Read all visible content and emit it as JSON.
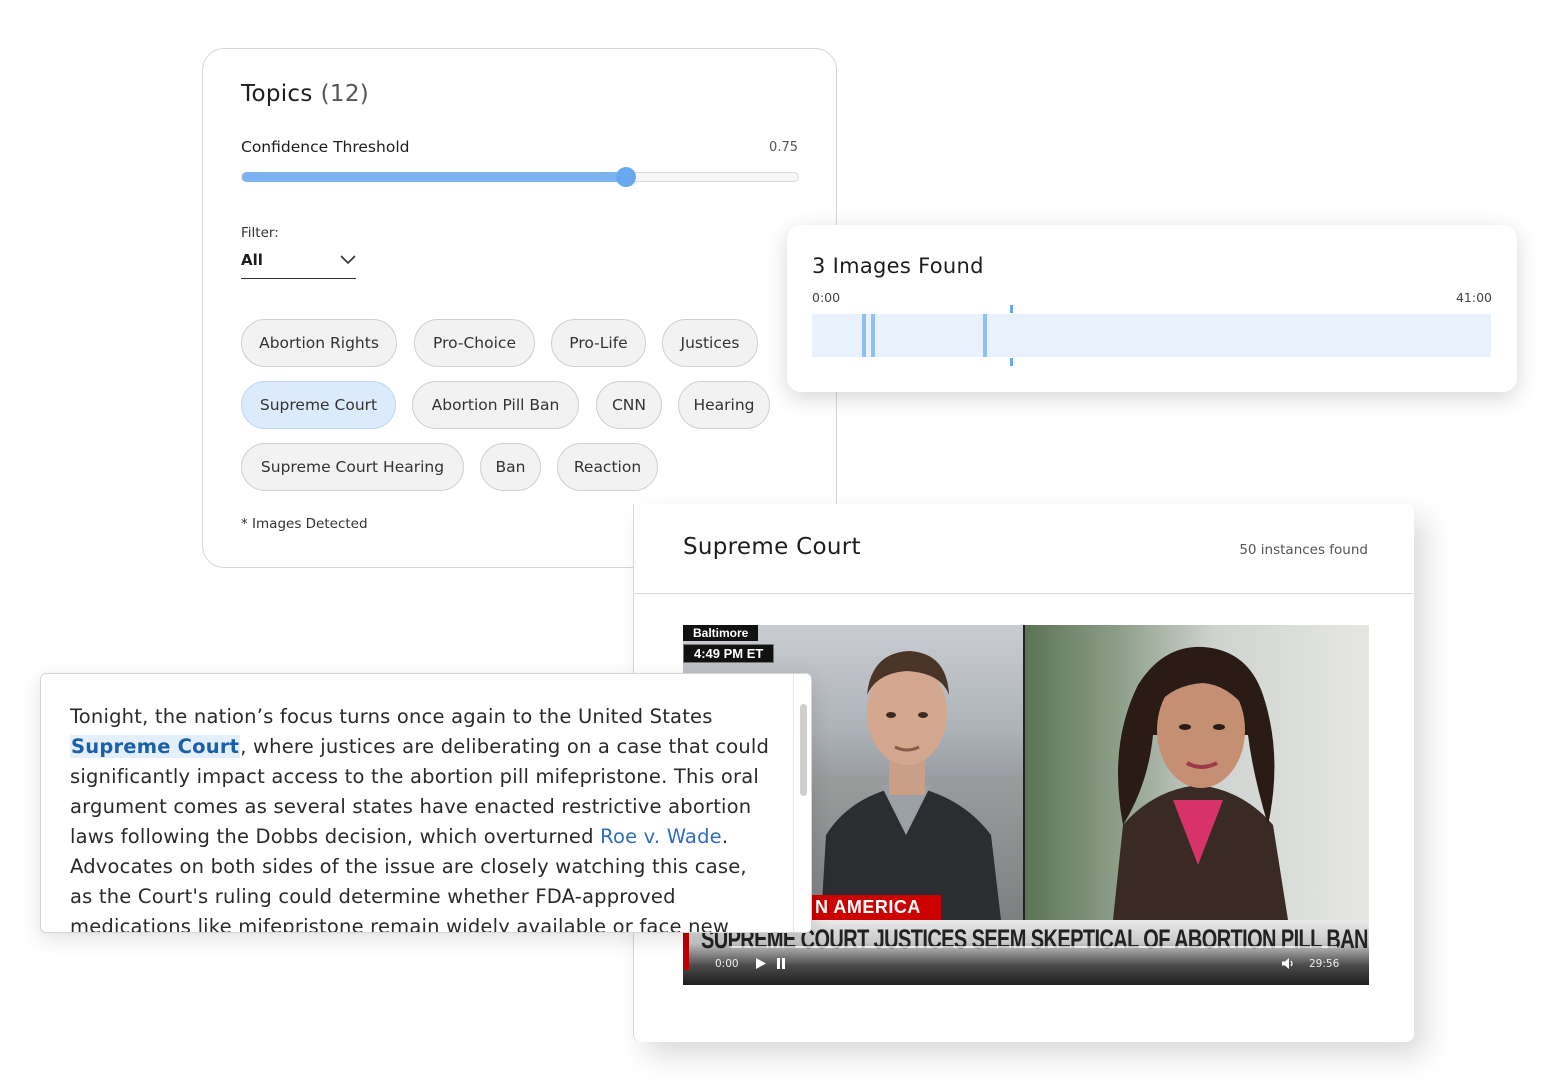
{
  "topics": {
    "title": "Topics",
    "count": "(12)",
    "confidence_label": "Confidence Threshold",
    "confidence_value": "0.75",
    "confidence_fraction": 0.69,
    "filter_label": "Filter:",
    "filter_value": "All",
    "chips": [
      {
        "label": "Abortion Rights",
        "active": false
      },
      {
        "label": "Pro-Choice",
        "active": false
      },
      {
        "label": "Pro-Life",
        "active": false
      },
      {
        "label": "Justices",
        "active": false
      },
      {
        "label": "Supreme Court",
        "active": true
      },
      {
        "label": "Abortion Pill Ban",
        "active": false
      },
      {
        "label": "CNN",
        "active": false
      },
      {
        "label": "Hearing",
        "active": false
      },
      {
        "label": "Supreme Court Hearing",
        "active": false
      },
      {
        "label": "Ban",
        "active": false
      },
      {
        "label": "Reaction",
        "active": false
      }
    ],
    "footnote": "* Images Detected"
  },
  "images": {
    "title": "3 Images Found",
    "start_time": "0:00",
    "end_time": "41:00"
  },
  "supreme_court": {
    "title": "Supreme Court",
    "count": "50 instances found",
    "video": {
      "location": "Baltimore",
      "time": "4:49 PM ET",
      "banner": "N AMERICA",
      "headline": "SUPREME COURT JUSTICES SEEM SKEPTICAL OF ABORTION PILL BAN",
      "current_time": "0:00",
      "duration": "29:56"
    }
  },
  "transcript": {
    "part1": "Tonight, the nation’s focus turns once again to the United States ",
    "highlight": "Supreme Court",
    "part2": ", where justices are deliberating on a case that could significantly impact access to the abortion pill mifepristone. This oral argument comes as several states have enacted restrictive abortion laws following the Dobbs decision, which overturned ",
    "link": "Roe v. Wade",
    "part3": ". Advocates on both sides of the issue are closely watching this case, as the Court's ruling could determine whether FDA-approved medications like mifepristone remain widely available or face new limitations."
  },
  "colors": {
    "accent": "#6aa7f1",
    "chip_active": "#dcebfb",
    "timeline_bg": "#e9f2fc",
    "highlight_text": "#1b5fa8"
  }
}
